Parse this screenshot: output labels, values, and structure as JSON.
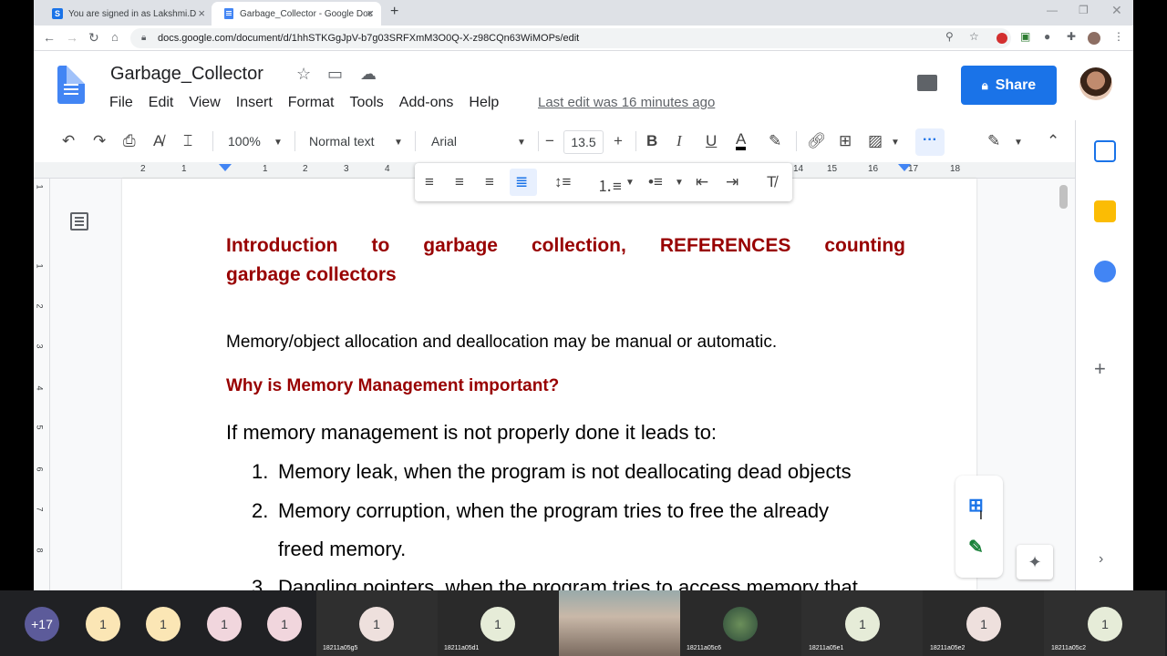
{
  "browser": {
    "tabs": [
      {
        "title": "You are signed in as Lakshmi.D",
        "favicon": "S"
      },
      {
        "title": "Garbage_Collector - Google Doc"
      }
    ],
    "url": "docs.google.com/document/d/1hhSTKGgJpV-b7g03SRFXmM3O0Q-X-z98CQn63WiMOPs/edit"
  },
  "doc": {
    "title": "Garbage_Collector",
    "menu": [
      "File",
      "Edit",
      "View",
      "Insert",
      "Format",
      "Tools",
      "Add-ons",
      "Help"
    ],
    "last_edit": "Last edit was 16 minutes ago",
    "share_label": "Share"
  },
  "toolbar": {
    "zoom": "100%",
    "style": "Normal text",
    "font": "Arial",
    "font_size": "13.5"
  },
  "ruler": {
    "marks": [
      "2",
      "1",
      "1",
      "2",
      "3",
      "4",
      "14",
      "15",
      "16",
      "17",
      "18"
    ]
  },
  "vruler": [
    "1",
    "1",
    "2",
    "3",
    "4",
    "5",
    "6",
    "7",
    "8"
  ],
  "content": {
    "heading1_line1": "Introduction to garbage collection, REFERENCES counting",
    "heading1_line2": "garbage collectors",
    "para1": "Memory/object allocation and deallocation may be manual or automatic.",
    "heading2": "Why is Memory Management important?",
    "para2": "If memory management is not properly done it leads to:",
    "list": [
      {
        "num": "1.",
        "text": "Memory leak, when the program is not deallocating dead objects"
      },
      {
        "num": "2.",
        "text": "Memory corruption, when the program tries to free the already"
      },
      {
        "num": "",
        "text": "freed memory."
      },
      {
        "num": "3.",
        "text": "Dangling pointers, when the program tries to access memory that"
      }
    ]
  },
  "meet": {
    "more_count": "+17",
    "participants": [
      {
        "label": "1",
        "name": ""
      },
      {
        "label": "1",
        "name": ""
      },
      {
        "label": "1",
        "name": ""
      },
      {
        "label": "1",
        "name": ""
      },
      {
        "label": "1",
        "name": "18211a05g5"
      },
      {
        "label": "1",
        "name": "18211a05d1"
      },
      {
        "label": "",
        "name": ""
      },
      {
        "label": "",
        "name": "18211a05c6"
      },
      {
        "label": "1",
        "name": "18211a05e1"
      },
      {
        "label": "1",
        "name": "18211a05e2"
      },
      {
        "label": "1",
        "name": "18211a05c2"
      }
    ]
  },
  "colors": {
    "heading": "#980000",
    "accent": "#1a73e8"
  }
}
